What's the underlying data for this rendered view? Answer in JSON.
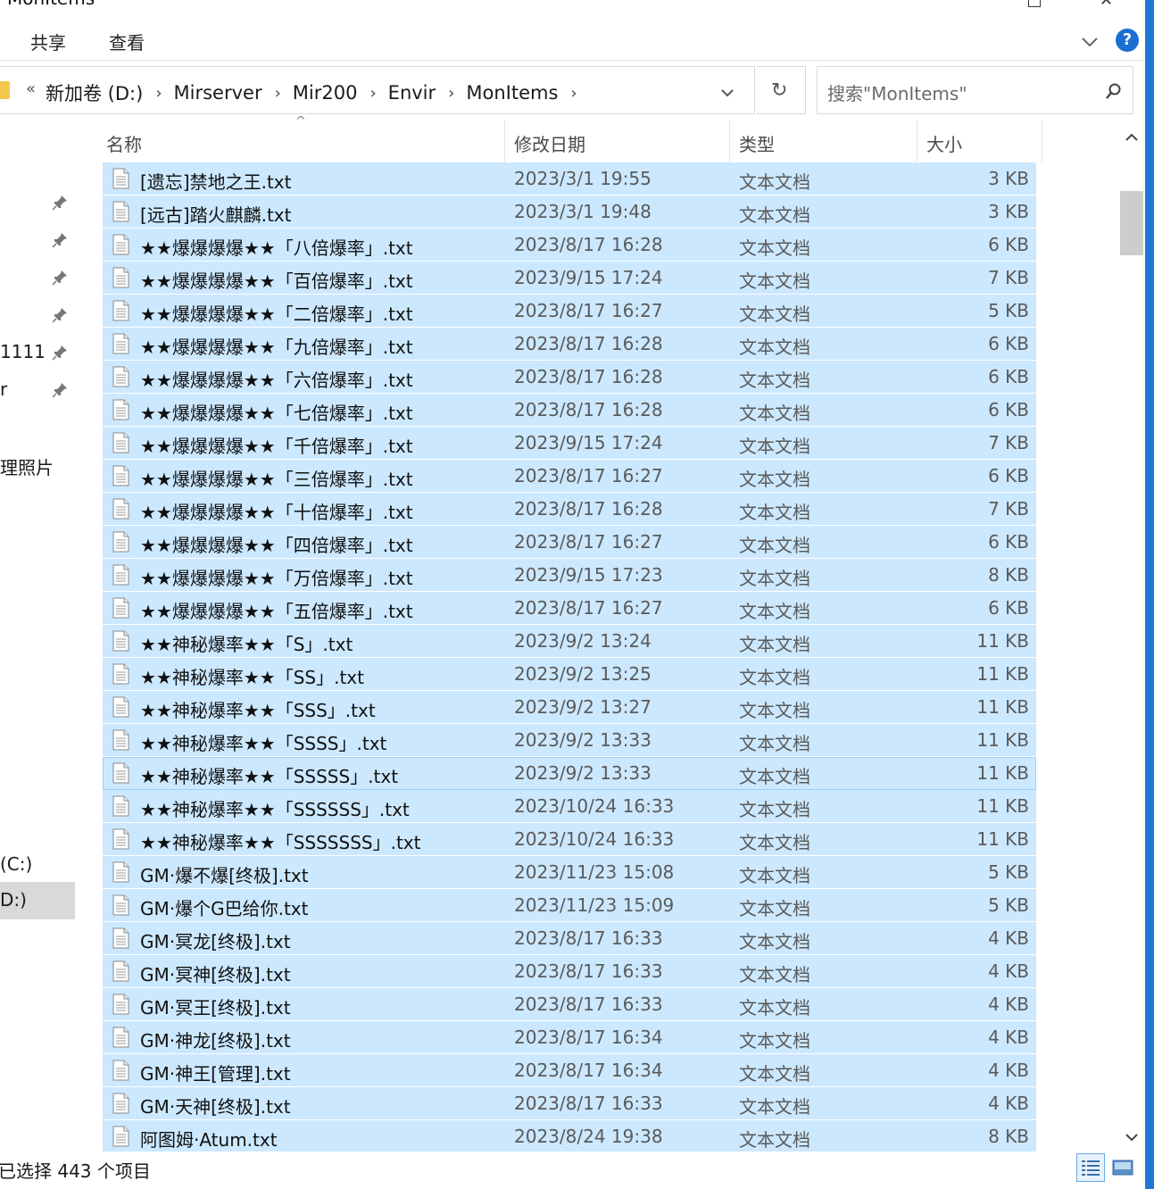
{
  "window": {
    "title": "MonItems",
    "close_glyph": "✕"
  },
  "ribbon": {
    "tabs": [
      "共享",
      "查看"
    ],
    "help_label": "?"
  },
  "address": {
    "back_glyph": "«",
    "crumbs": [
      "新加卷 (D:)",
      "Mirserver",
      "Mir200",
      "Envir",
      "MonItems"
    ],
    "separator": "›",
    "refresh_glyph": "↻"
  },
  "search": {
    "placeholder": "搜索\"MonItems\""
  },
  "nav": {
    "items": [
      "1111",
      "r",
      "理照片",
      "(C:)",
      "D:)"
    ]
  },
  "columns": {
    "name": "名称",
    "date": "修改日期",
    "type": "类型",
    "size": "大小",
    "sort_glyph": "^"
  },
  "files": [
    {
      "name": "[遗忘]禁地之王.txt",
      "date": "2023/3/1 19:55",
      "type": "文本文档",
      "size": "3 KB"
    },
    {
      "name": "[远古]踏火麒麟.txt",
      "date": "2023/3/1 19:48",
      "type": "文本文档",
      "size": "3 KB"
    },
    {
      "name": "★★爆爆爆爆★★「八倍爆率」.txt",
      "date": "2023/8/17 16:28",
      "type": "文本文档",
      "size": "6 KB"
    },
    {
      "name": "★★爆爆爆爆★★「百倍爆率」.txt",
      "date": "2023/9/15 17:24",
      "type": "文本文档",
      "size": "7 KB"
    },
    {
      "name": "★★爆爆爆爆★★「二倍爆率」.txt",
      "date": "2023/8/17 16:27",
      "type": "文本文档",
      "size": "5 KB"
    },
    {
      "name": "★★爆爆爆爆★★「九倍爆率」.txt",
      "date": "2023/8/17 16:28",
      "type": "文本文档",
      "size": "6 KB"
    },
    {
      "name": "★★爆爆爆爆★★「六倍爆率」.txt",
      "date": "2023/8/17 16:28",
      "type": "文本文档",
      "size": "6 KB"
    },
    {
      "name": "★★爆爆爆爆★★「七倍爆率」.txt",
      "date": "2023/8/17 16:28",
      "type": "文本文档",
      "size": "6 KB"
    },
    {
      "name": "★★爆爆爆爆★★「千倍爆率」.txt",
      "date": "2023/9/15 17:24",
      "type": "文本文档",
      "size": "7 KB"
    },
    {
      "name": "★★爆爆爆爆★★「三倍爆率」.txt",
      "date": "2023/8/17 16:27",
      "type": "文本文档",
      "size": "6 KB"
    },
    {
      "name": "★★爆爆爆爆★★「十倍爆率」.txt",
      "date": "2023/8/17 16:28",
      "type": "文本文档",
      "size": "7 KB"
    },
    {
      "name": "★★爆爆爆爆★★「四倍爆率」.txt",
      "date": "2023/8/17 16:27",
      "type": "文本文档",
      "size": "6 KB"
    },
    {
      "name": "★★爆爆爆爆★★「万倍爆率」.txt",
      "date": "2023/9/15 17:23",
      "type": "文本文档",
      "size": "8 KB"
    },
    {
      "name": "★★爆爆爆爆★★「五倍爆率」.txt",
      "date": "2023/8/17 16:27",
      "type": "文本文档",
      "size": "6 KB"
    },
    {
      "name": "★★神秘爆率★★「S」.txt",
      "date": "2023/9/2 13:24",
      "type": "文本文档",
      "size": "11 KB"
    },
    {
      "name": "★★神秘爆率★★「SS」.txt",
      "date": "2023/9/2 13:25",
      "type": "文本文档",
      "size": "11 KB"
    },
    {
      "name": "★★神秘爆率★★「SSS」.txt",
      "date": "2023/9/2 13:27",
      "type": "文本文档",
      "size": "11 KB"
    },
    {
      "name": "★★神秘爆率★★「SSSS」.txt",
      "date": "2023/9/2 13:33",
      "type": "文本文档",
      "size": "11 KB"
    },
    {
      "name": "★★神秘爆率★★「SSSSS」.txt",
      "date": "2023/9/2 13:33",
      "type": "文本文档",
      "size": "11 KB"
    },
    {
      "name": "★★神秘爆率★★「SSSSSS」.txt",
      "date": "2023/10/24 16:33",
      "type": "文本文档",
      "size": "11 KB"
    },
    {
      "name": "★★神秘爆率★★「SSSSSSS」.txt",
      "date": "2023/10/24 16:33",
      "type": "文本文档",
      "size": "11 KB"
    },
    {
      "name": "GM·爆不爆[终极].txt",
      "date": "2023/11/23 15:08",
      "type": "文本文档",
      "size": "5 KB"
    },
    {
      "name": "GM·爆个G巴给你.txt",
      "date": "2023/11/23 15:09",
      "type": "文本文档",
      "size": "5 KB"
    },
    {
      "name": "GM·冥龙[终极].txt",
      "date": "2023/8/17 16:33",
      "type": "文本文档",
      "size": "4 KB"
    },
    {
      "name": "GM·冥神[终极].txt",
      "date": "2023/8/17 16:33",
      "type": "文本文档",
      "size": "4 KB"
    },
    {
      "name": "GM·冥王[终极].txt",
      "date": "2023/8/17 16:33",
      "type": "文本文档",
      "size": "4 KB"
    },
    {
      "name": "GM·神龙[终极].txt",
      "date": "2023/8/17 16:34",
      "type": "文本文档",
      "size": "4 KB"
    },
    {
      "name": "GM·神王[管理].txt",
      "date": "2023/8/17 16:34",
      "type": "文本文档",
      "size": "4 KB"
    },
    {
      "name": "GM·天神[终极].txt",
      "date": "2023/8/17 16:33",
      "type": "文本文档",
      "size": "4 KB"
    },
    {
      "name": "阿图姆·Atum.txt",
      "date": "2023/8/24 19:38",
      "type": "文本文档",
      "size": "8 KB"
    }
  ],
  "status": {
    "text": "已选择 443 个项目"
  },
  "colors": {
    "selection": "#cce8ff",
    "accent": "#1e78d6"
  }
}
